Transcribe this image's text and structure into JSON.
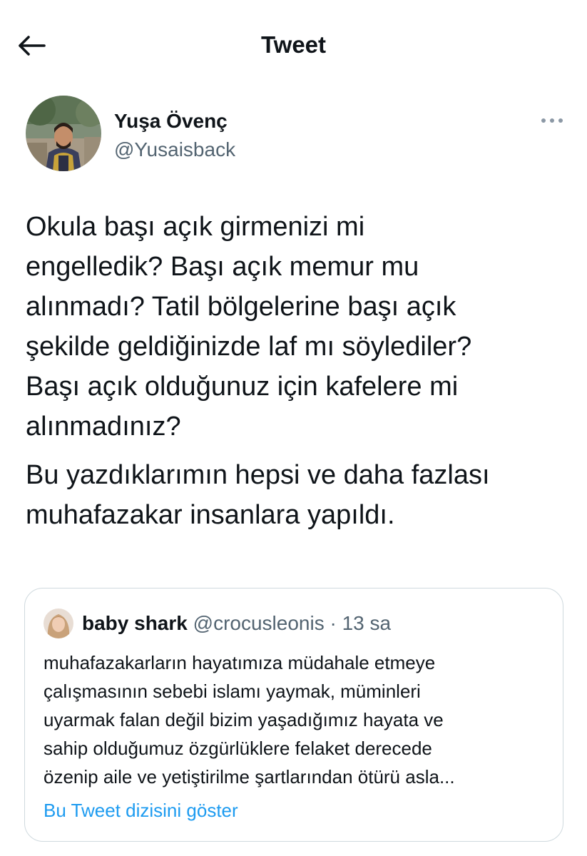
{
  "header": {
    "title": "Tweet",
    "back_icon": "arrow-left-icon"
  },
  "author": {
    "name": "Yuşa Övenç",
    "handle": "@Yusaisback",
    "more_icon": "more-horizontal-icon"
  },
  "tweet": {
    "paragraphs": [
      "Okula başı açık girmenizi mi\nengelledik? Başı açık memur mu\nalınmadı? Tatil bölgelerine başı açık\nşekilde geldiğinizde laf mı söylediler?\nBaşı açık olduğunuz için kafelere mi\nalınmadınız?",
      "Bu yazdıklarımın hepsi ve daha fazlası\nmuhafazakar insanlara yapıldı."
    ]
  },
  "quoted": {
    "name": "baby shark",
    "handle": "@crocusleonis",
    "separator": "·",
    "time": "13 sa",
    "text": "muhafazakarların hayatımıza müdahale etmeye\nçalışmasının sebebi islamı yaymak, müminleri\nuyarmak falan değil bizim yaşadığımız hayata ve\nsahip olduğumuz özgürlüklere felaket derecede\nözenip aile ve yetiştirilme şartlarından ötürü asla...",
    "show_thread": "Bu Tweet dizisini göster"
  },
  "colors": {
    "text": "#0f1419",
    "secondary": "#536471",
    "link": "#1d9bf0",
    "border": "#cfd9de"
  }
}
